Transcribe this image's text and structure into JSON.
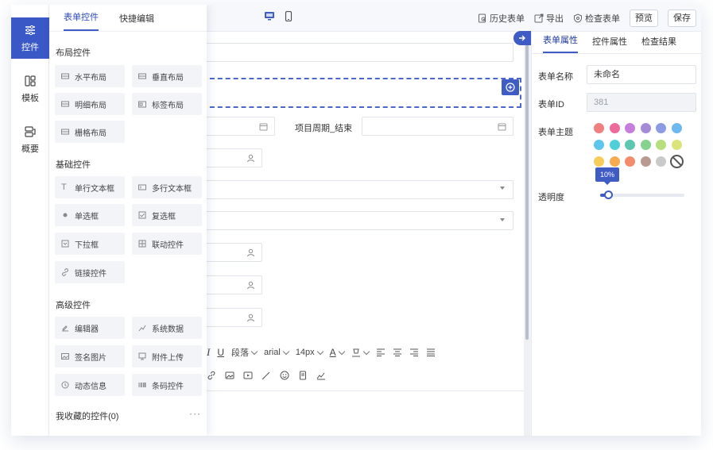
{
  "topbar": {
    "actions": [
      {
        "label": "历史表单",
        "icon": "history-icon"
      },
      {
        "label": "导出",
        "icon": "export-icon"
      },
      {
        "label": "检查表单",
        "icon": "check-form-icon"
      }
    ],
    "preview_label": "预览",
    "save_label": "保存",
    "device_icons": [
      "desktop-icon",
      "mobile-icon"
    ]
  },
  "leftnav": {
    "items": [
      {
        "label": "控件",
        "icon": "controls-icon",
        "active": true
      },
      {
        "label": "模板",
        "icon": "template-icon",
        "active": false
      },
      {
        "label": "概要",
        "icon": "overview-icon",
        "active": false
      }
    ]
  },
  "widget_panel": {
    "tabs": [
      {
        "label": "表单控件",
        "active": true
      },
      {
        "label": "快捷编辑",
        "active": false
      }
    ],
    "groups": [
      {
        "title": "布局控件",
        "items": [
          {
            "label": "水平布局",
            "icon": "horizontal-layout-icon"
          },
          {
            "label": "垂直布局",
            "icon": "vertical-layout-icon"
          },
          {
            "label": "明细布局",
            "icon": "detail-layout-icon"
          },
          {
            "label": "标签布局",
            "icon": "tab-layout-icon"
          },
          {
            "label": "栅格布局",
            "icon": "grid-layout-icon"
          }
        ]
      },
      {
        "title": "基础控件",
        "items": [
          {
            "label": "单行文本框",
            "icon": "text-input-icon"
          },
          {
            "label": "多行文本框",
            "icon": "textarea-icon"
          },
          {
            "label": "单选框",
            "icon": "radio-icon"
          },
          {
            "label": "复选框",
            "icon": "checkbox-icon"
          },
          {
            "label": "下拉框",
            "icon": "dropdown-icon"
          },
          {
            "label": "联动控件",
            "icon": "cascade-icon"
          },
          {
            "label": "链接控件",
            "icon": "link-icon"
          }
        ]
      },
      {
        "title": "高级控件",
        "items": [
          {
            "label": "编辑器",
            "icon": "editor-icon"
          },
          {
            "label": "系统数据",
            "icon": "system-data-icon"
          },
          {
            "label": "签名图片",
            "icon": "signature-icon"
          },
          {
            "label": "附件上传",
            "icon": "upload-icon"
          },
          {
            "label": "动态信息",
            "icon": "dynamic-info-icon"
          },
          {
            "label": "条码控件",
            "icon": "barcode-icon"
          }
        ]
      }
    ],
    "favorites_label": "我收藏的控件(0)",
    "more_label": "···"
  },
  "canvas": {
    "project_end_label": "项目周期_结束",
    "editor_toolbar": {
      "paragraph": "段落",
      "font": "arial",
      "size": "14px"
    }
  },
  "right_panel": {
    "tabs": [
      {
        "label": "表单属性",
        "active": true
      },
      {
        "label": "控件属性",
        "active": false
      },
      {
        "label": "检查结果",
        "active": false
      }
    ],
    "form_name_label": "表单名称",
    "form_name_value": "未命名",
    "form_id_label": "表单ID",
    "form_id_value": "381",
    "theme_label": "表单主题",
    "theme_colors": [
      "#f07f7f",
      "#ec6b9b",
      "#c77ddc",
      "#a48bd8",
      "#8c9be2",
      "#6fb8ef",
      "#5cc6ec",
      "#4fd0d8",
      "#5cc6b0",
      "#86d38f",
      "#b6de7e",
      "#dbe37a",
      "#f6cc5a",
      "#f7ab4f",
      "#f28c6a",
      "#b99a92",
      "#c9c9c9"
    ],
    "opacity_label": "透明度",
    "opacity_tooltip": "10%",
    "opacity_value": 0.1
  }
}
